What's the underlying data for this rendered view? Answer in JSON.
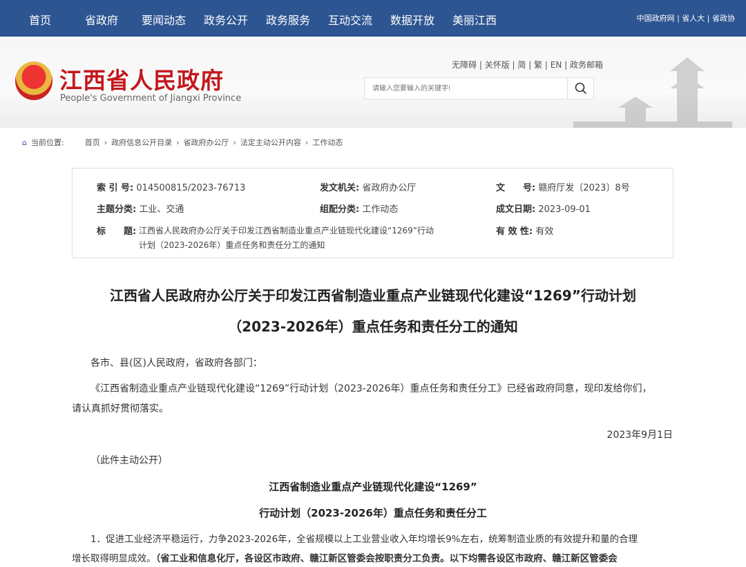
{
  "nav": {
    "items": [
      "首页",
      "省政府",
      "要闻动态",
      "政务公开",
      "政务服务",
      "互动交流",
      "数据开放",
      "美丽江西"
    ],
    "links": [
      "中国政府网",
      "省人大",
      "省政协"
    ]
  },
  "header": {
    "title": "江西省人民政府",
    "subtitle": "People's Government of Jiangxi Province",
    "util": [
      "无障碍",
      "关怀版",
      "简",
      "繁",
      "EN",
      "政务邮箱"
    ],
    "search_placeholder": "请输入您要输入的关键字!"
  },
  "breadcrumb": {
    "label": "当前位置:",
    "items": [
      "首页",
      "政府信息公开目录",
      "省政府办公厅",
      "法定主动公开内容",
      "工作动态"
    ]
  },
  "meta": {
    "index_label": "索 引 号:",
    "index": "014500815/2023-76713",
    "org_label": "发文机关:",
    "org": "省政府办公厅",
    "docno_label": "文　　号:",
    "docno": "赣府厅发〔2023〕8号",
    "topic_label": "主题分类:",
    "topic": "工业、交通",
    "cat_label": "组配分类:",
    "cat": "工作动态",
    "date_label": "成文日期:",
    "date": "2023-09-01",
    "title_label": "标　　题:",
    "title1": "江西省人民政府办公厅关于印发江西省制造业重点产业链现代化建设“1269”行动",
    "title2": "计划（2023-2026年）重点任务和责任分工的通知",
    "valid_label": "有 效 性:",
    "valid": "有效"
  },
  "article": {
    "title1": "江西省人民政府办公厅关于印发江西省制造业重点产业链现代化建设“1269”行动计划",
    "title2": "（2023-2026年）重点任务和责任分工的通知",
    "salutation": "各市、县(区)人民政府，省政府各部门：",
    "body1": "《江西省制造业重点产业链现代化建设“1269”行动计划（2023-2026年）重点任务和责任分工》已经省政府同意，现印发给你们，",
    "body2": "请认真抓好贯彻落实。",
    "date": "2023年9月1日",
    "note": "（此件主动公开）",
    "sub1": "江西省制造业重点产业链现代化建设“1269”",
    "sub2": "行动计划（2023-2026年）重点任务和责任分工",
    "item1a": "1．促进工业经济平稳运行，力争2023-2026年，全省规模以上工业营业收入年均增长9%左右，统筹制造业质的有效提升和量的合理",
    "item1b": "增长取得明显成效。",
    "item1c": "（省工业和信息化厅，各设区市政府、赣江新区管委会按职责分工负责。以下均需各设区市政府、赣江新区管委会"
  }
}
